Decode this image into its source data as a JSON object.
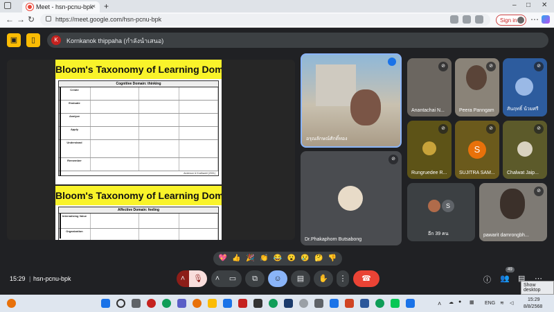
{
  "browser": {
    "tab_title": "Meet - hsn-pcnu-bpk",
    "url": "https://meet.google.com/hsn-pcnu-bpk",
    "sign_in": "Sign in",
    "new_tab": "+",
    "close_tab": "×",
    "minimize": "–",
    "maximize": "□",
    "close_window": "✕"
  },
  "meet": {
    "presenter": "Kornkanok thippaha (กำลังนำเสนอ)",
    "presenter_initial": "K",
    "clock": "15:29",
    "room": "hsn-pcnu-bpk",
    "participant_count_badge": "49",
    "tooltip": "Show desktop"
  },
  "slide1": {
    "title": "Bloom's Taxonomy of Learning Domains",
    "domain": "Cognitive Domain: thinking",
    "levels": [
      "Create",
      "Evaluate",
      "Analyze",
      "Apply",
      "Understand",
      "Remember"
    ],
    "citation": "Anderson & Krathwohl (2001)"
  },
  "slide2": {
    "title": "Bloom's Taxonomy of Learning Domains",
    "domain": "Affective Domain: feeling",
    "levels": [
      "Internalizing Value",
      "Organization"
    ]
  },
  "tiles": {
    "main1": "อรุณลักษณ์ศักดิ์ทอง",
    "main2": "Dr.Phakaphorn Butsabong",
    "p1": "Anantachai N...",
    "p2": "Peera Panngam",
    "p3": "สันฤทธิ์ น้วมศรี",
    "p4": "Rungruedee R...",
    "p5": "SUJITRA SAM...",
    "p5_initial": "S",
    "p6": "Chalwat Jaip...",
    "others": "อีก 39 คน",
    "others_initial": "S",
    "p7": "pawarit damrongbh..."
  },
  "reactions": [
    "💖",
    "👍",
    "🎉",
    "👏",
    "😂",
    "😮",
    "😢",
    "🤔",
    "👎"
  ],
  "taskbar": {
    "lang": "ENG",
    "time": "15:29",
    "date": "8/8/2568"
  },
  "colors": {
    "meet_bg": "#202124",
    "tile_bg": "#3c4043",
    "accent_yellow": "#fbbc04",
    "end_call": "#ea4335",
    "active_blue": "#8ab4f8"
  }
}
